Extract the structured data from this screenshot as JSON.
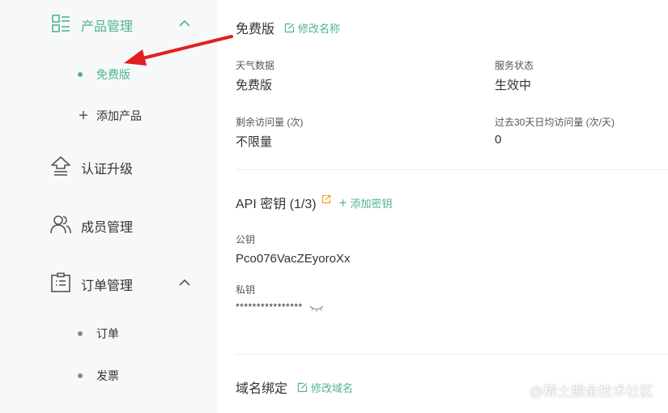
{
  "sidebar": {
    "product_mgmt": {
      "label": "产品管理",
      "icon": "product-grid-icon"
    },
    "free_edition": {
      "label": "免费版"
    },
    "add_product": {
      "label": "添加产品",
      "icon": "plus-icon"
    },
    "certification": {
      "label": "认证升级",
      "icon": "upgrade-icon"
    },
    "members": {
      "label": "成员管理",
      "icon": "members-icon"
    },
    "order_mgmt": {
      "label": "订单管理",
      "icon": "order-icon"
    },
    "orders": {
      "label": "订单"
    },
    "invoices": {
      "label": "发票"
    }
  },
  "main": {
    "plan_title": "免费版",
    "rename_link": "修改名称",
    "weather_label": "天气数据",
    "weather_value": "免费版",
    "service_label": "服务状态",
    "service_value": "生效中",
    "remaining_label": "剩余访问量 (次)",
    "remaining_value": "不限量",
    "avg_label": "过去30天日均访问量 (次/天)",
    "avg_value": "0",
    "api_title": "API 密钥 (1/3)",
    "add_key_link": "添加密钥",
    "public_key_label": "公钥",
    "public_key_value": "Pco076VacZEyoroXx",
    "private_key_label": "私钥",
    "private_key_value": "****************",
    "domain_title": "域名绑定",
    "edit_domain_link": "修改域名"
  },
  "watermark": "@稀土掘金技术社区",
  "colors": {
    "accent": "#4fb58a",
    "annotation_arrow": "#e02020",
    "sidebar_bg": "#f7f8fa"
  }
}
